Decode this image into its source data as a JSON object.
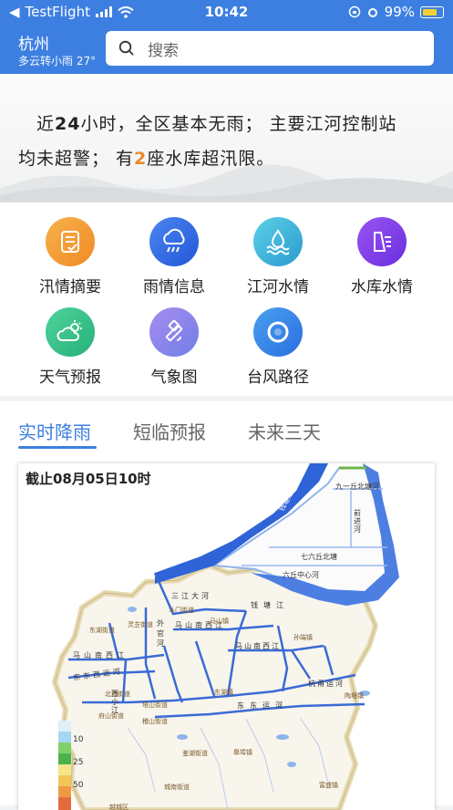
{
  "status_bar": {
    "back_app": "TestFlight",
    "time": "10:42",
    "battery": "99%"
  },
  "header": {
    "city": "杭州",
    "weather": "多云转小雨 27°",
    "search_placeholder": "搜索"
  },
  "banner": {
    "line1_prefix": "近",
    "line1_num": "24",
    "line1_suffix": "小时，全区基本无雨； 主要江河控制站",
    "line2_prefix": "均未超警； 有",
    "line2_num": "2",
    "line2_suffix": "座水库超汛限。"
  },
  "grid": [
    {
      "label": "汛情摘要",
      "icon": "flood-summary-icon",
      "color": "#f39a2e"
    },
    {
      "label": "雨情信息",
      "icon": "rain-cloud-icon",
      "color": "#2f6ee8"
    },
    {
      "label": "江河水情",
      "icon": "river-water-icon",
      "color": "#3bb7d6"
    },
    {
      "label": "水库水情",
      "icon": "reservoir-icon",
      "color": "#7a3ee6"
    },
    {
      "label": "天气预报",
      "icon": "weather-forecast-icon",
      "color": "#35c28a"
    },
    {
      "label": "气象图",
      "icon": "satellite-icon",
      "color": "#8a6ee8"
    },
    {
      "label": "台风路径",
      "icon": "typhoon-icon",
      "color": "#2f86e8"
    }
  ],
  "tabs": [
    {
      "label": "实时降雨",
      "active": true
    },
    {
      "label": "短临预报",
      "active": false
    },
    {
      "label": "未来三天",
      "active": false
    }
  ],
  "map": {
    "title": "截止08月05日10时",
    "legend_labels": [
      "10",
      "25",
      "50"
    ],
    "river_labels": [
      "钱塘江",
      "九一丘北塘河",
      "前进河",
      "七六丘北塘",
      "六丘中心河",
      "三江大河",
      "钱塘江",
      "马山南西江",
      "马山南西江",
      "马山南西江",
      "东东西运河",
      "杭甬运河",
      "东东运河",
      "西小江",
      "外官河"
    ],
    "place_labels": [
      "斗门街道",
      "东湖街道",
      "灵芝街道",
      "马山镇",
      "孙端镇",
      "北海街道",
      "府山街道",
      "塔山街道",
      "稽山街道",
      "东湖镇",
      "陶堰镇",
      "皋埠镇",
      "富盛镇",
      "城南街道",
      "鉴湖街道",
      "越城区"
    ]
  }
}
